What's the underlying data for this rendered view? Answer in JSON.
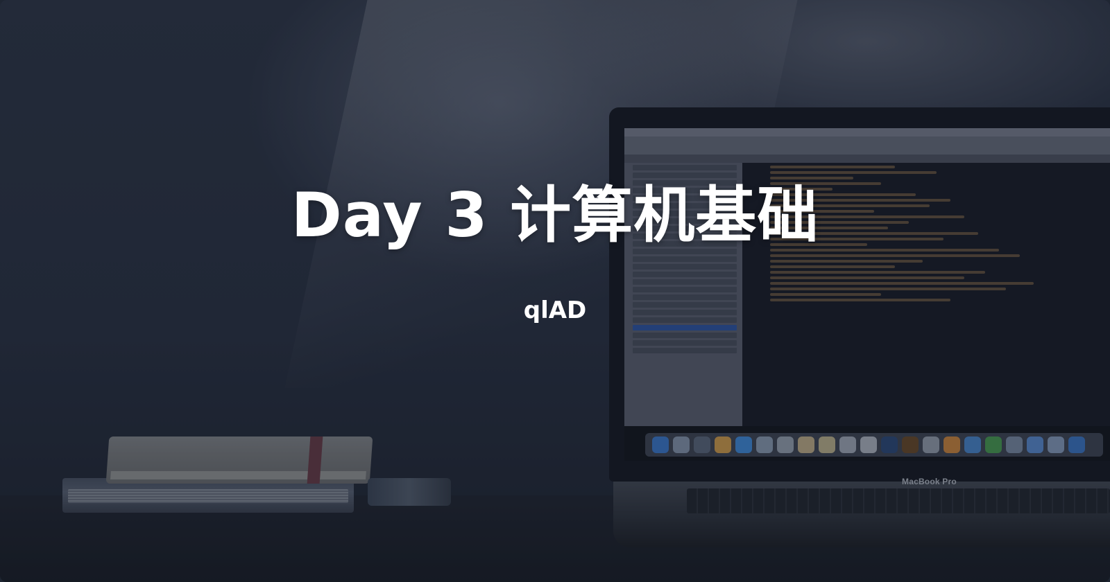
{
  "hero": {
    "title": "Day 3 计算机基础",
    "author": "qlAD"
  },
  "laptop": {
    "brand_text": "MacBook Pro"
  },
  "background": {
    "overlay_color": "#141a28",
    "wall_color": "#2c3444"
  }
}
